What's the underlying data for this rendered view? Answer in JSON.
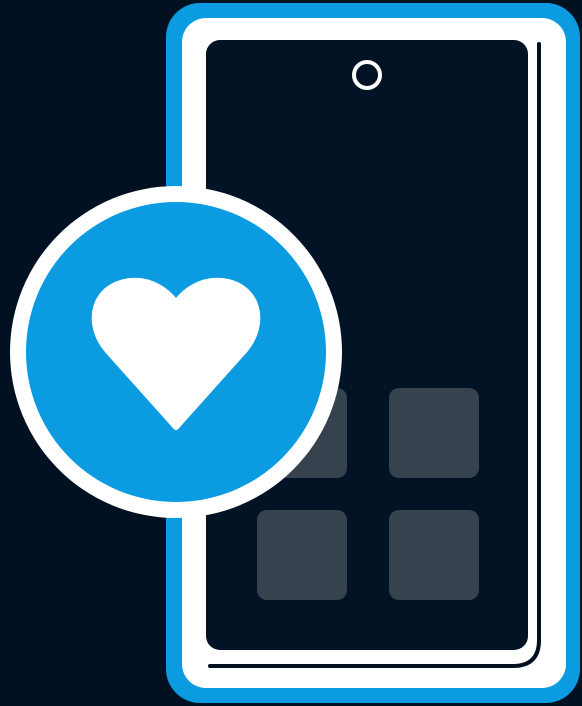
{
  "illustration": {
    "icons": [
      "smartphone-icon",
      "camera-icon",
      "heart-icon",
      "app-tile-icon"
    ],
    "colors": {
      "background": "#011121",
      "accent_blue": "#0A9BE1",
      "white": "#FFFFFF",
      "screen": "#021326",
      "tile": "#36434F"
    }
  }
}
